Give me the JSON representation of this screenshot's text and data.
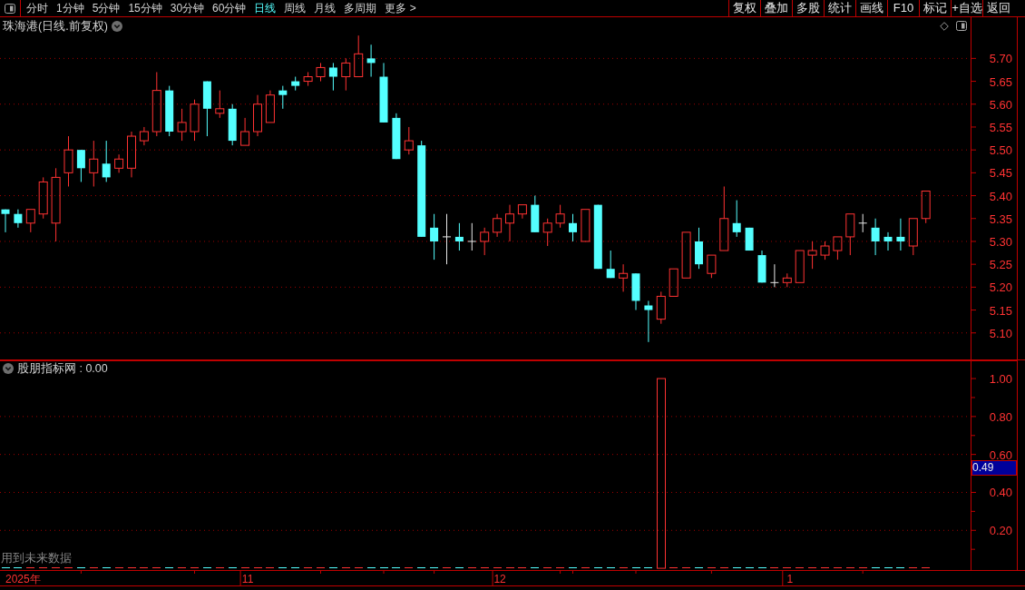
{
  "toolbar": {
    "period_tabs": [
      {
        "label": "分时",
        "selected": false
      },
      {
        "label": "1分钟",
        "selected": false
      },
      {
        "label": "5分钟",
        "selected": false
      },
      {
        "label": "15分钟",
        "selected": false
      },
      {
        "label": "30分钟",
        "selected": false
      },
      {
        "label": "60分钟",
        "selected": false
      },
      {
        "label": "日线",
        "selected": true
      },
      {
        "label": "周线",
        "selected": false
      },
      {
        "label": "月线",
        "selected": false
      },
      {
        "label": "多周期",
        "selected": false
      },
      {
        "label": "更多 >",
        "selected": false
      }
    ],
    "buttons": [
      "复权",
      "叠加",
      "多股",
      "统计",
      "画线",
      "F10",
      "标记",
      "+自选",
      "返回"
    ]
  },
  "main_chart": {
    "title": "珠海港(日线.前复权)",
    "chart_data": [
      {
        "type": "candlestick",
        "ylim": [
          5.04,
          5.79
        ],
        "yticks": [
          {
            "value": 5.1,
            "label": "5.10"
          },
          {
            "value": 5.15,
            "label": "5.15"
          },
          {
            "value": 5.2,
            "label": "5.20"
          },
          {
            "value": 5.25,
            "label": "5.25"
          },
          {
            "value": 5.3,
            "label": "5.30"
          },
          {
            "value": 5.35,
            "label": "5.35"
          },
          {
            "value": 5.4,
            "label": "5.40"
          },
          {
            "value": 5.45,
            "label": "5.45"
          },
          {
            "value": 5.5,
            "label": "5.50"
          },
          {
            "value": 5.55,
            "label": "5.55"
          },
          {
            "value": 5.6,
            "label": "5.60"
          },
          {
            "value": 5.65,
            "label": "5.65"
          },
          {
            "value": 5.7,
            "label": "5.70"
          }
        ],
        "grid": true,
        "ohlc": [
          [
            5.37,
            5.37,
            5.32,
            5.36
          ],
          [
            5.36,
            5.37,
            5.33,
            5.34
          ],
          [
            5.34,
            5.37,
            5.32,
            5.37
          ],
          [
            5.36,
            5.44,
            5.35,
            5.43
          ],
          [
            5.34,
            5.46,
            5.3,
            5.44
          ],
          [
            5.45,
            5.53,
            5.42,
            5.5
          ],
          [
            5.5,
            5.5,
            5.43,
            5.46
          ],
          [
            5.45,
            5.52,
            5.42,
            5.48
          ],
          [
            5.47,
            5.52,
            5.43,
            5.44
          ],
          [
            5.46,
            5.49,
            5.45,
            5.48
          ],
          [
            5.46,
            5.54,
            5.44,
            5.53
          ],
          [
            5.52,
            5.55,
            5.51,
            5.54
          ],
          [
            5.54,
            5.67,
            5.53,
            5.63
          ],
          [
            5.63,
            5.64,
            5.53,
            5.54
          ],
          [
            5.54,
            5.59,
            5.52,
            5.56
          ],
          [
            5.54,
            5.61,
            5.52,
            5.6
          ],
          [
            5.65,
            5.65,
            5.53,
            5.59
          ],
          [
            5.58,
            5.63,
            5.57,
            5.59
          ],
          [
            5.59,
            5.6,
            5.51,
            5.52
          ],
          [
            5.51,
            5.57,
            5.51,
            5.54
          ],
          [
            5.54,
            5.62,
            5.53,
            5.6
          ],
          [
            5.56,
            5.63,
            5.56,
            5.62
          ],
          [
            5.63,
            5.64,
            5.59,
            5.62
          ],
          [
            5.65,
            5.66,
            5.63,
            5.64
          ],
          [
            5.65,
            5.67,
            5.64,
            5.66
          ],
          [
            5.66,
            5.69,
            5.65,
            5.68
          ],
          [
            5.68,
            5.69,
            5.63,
            5.66
          ],
          [
            5.66,
            5.7,
            5.63,
            5.69
          ],
          [
            5.66,
            5.75,
            5.66,
            5.71
          ],
          [
            5.7,
            5.73,
            5.66,
            5.69
          ],
          [
            5.66,
            5.69,
            5.56,
            5.56
          ],
          [
            5.57,
            5.58,
            5.48,
            5.48
          ],
          [
            5.5,
            5.55,
            5.49,
            5.52
          ],
          [
            5.51,
            5.52,
            5.31,
            5.31
          ],
          [
            5.33,
            5.36,
            5.26,
            5.3
          ],
          [
            5.31,
            5.36,
            5.25,
            5.31
          ],
          [
            5.31,
            5.34,
            5.28,
            5.3
          ],
          [
            5.3,
            5.34,
            5.28,
            5.3
          ],
          [
            5.3,
            5.33,
            5.27,
            5.32
          ],
          [
            5.32,
            5.36,
            5.31,
            5.35
          ],
          [
            5.34,
            5.38,
            5.3,
            5.36
          ],
          [
            5.36,
            5.38,
            5.35,
            5.38
          ],
          [
            5.38,
            5.4,
            5.32,
            5.32
          ],
          [
            5.32,
            5.35,
            5.29,
            5.34
          ],
          [
            5.34,
            5.38,
            5.33,
            5.36
          ],
          [
            5.34,
            5.36,
            5.3,
            5.32
          ],
          [
            5.3,
            5.37,
            5.3,
            5.37
          ],
          [
            5.38,
            5.38,
            5.24,
            5.24
          ],
          [
            5.24,
            5.28,
            5.22,
            5.22
          ],
          [
            5.22,
            5.25,
            5.19,
            5.23
          ],
          [
            5.23,
            5.23,
            5.15,
            5.17
          ],
          [
            5.16,
            5.17,
            5.08,
            5.15
          ],
          [
            5.13,
            5.19,
            5.12,
            5.18
          ],
          [
            5.18,
            5.24,
            5.18,
            5.24
          ],
          [
            5.22,
            5.32,
            5.22,
            5.32
          ],
          [
            5.3,
            5.33,
            5.24,
            5.25
          ],
          [
            5.23,
            5.27,
            5.22,
            5.27
          ],
          [
            5.28,
            5.42,
            5.28,
            5.35
          ],
          [
            5.34,
            5.39,
            5.31,
            5.32
          ],
          [
            5.33,
            5.33,
            5.28,
            5.28
          ],
          [
            5.27,
            5.28,
            5.21,
            5.21
          ],
          [
            5.21,
            5.25,
            5.2,
            5.21
          ],
          [
            5.21,
            5.23,
            5.2,
            5.22
          ],
          [
            5.21,
            5.28,
            5.21,
            5.28
          ],
          [
            5.27,
            5.3,
            5.24,
            5.28
          ],
          [
            5.27,
            5.3,
            5.26,
            5.29
          ],
          [
            5.28,
            5.31,
            5.26,
            5.31
          ],
          [
            5.31,
            5.36,
            5.27,
            5.36
          ],
          [
            5.34,
            5.36,
            5.32,
            5.34
          ],
          [
            5.33,
            5.35,
            5.27,
            5.3
          ],
          [
            5.31,
            5.32,
            5.28,
            5.3
          ],
          [
            5.31,
            5.35,
            5.28,
            5.3
          ],
          [
            5.29,
            5.35,
            5.27,
            5.35
          ],
          [
            5.35,
            5.41,
            5.34,
            5.41
          ]
        ]
      }
    ]
  },
  "indicator": {
    "header": "股朋指标网 : 0.00",
    "value_marker": "0.49",
    "note": "用到未来数据",
    "time_axis_year": "2025年",
    "chart_data": [
      {
        "type": "bar",
        "ylim": [
          -0.014,
          1.096
        ],
        "yticks": [
          {
            "value": 0.2,
            "label": "0.20"
          },
          {
            "value": 0.4,
            "label": "0.40"
          },
          {
            "value": 0.6,
            "label": "0.60"
          },
          {
            "value": 0.8,
            "label": "0.80"
          },
          {
            "value": 1.0,
            "label": "1.00"
          }
        ],
        "grid": true,
        "categories": [
          null,
          null,
          null,
          null,
          null,
          null,
          null,
          null,
          null,
          null,
          null,
          null,
          null,
          null,
          null,
          null,
          null,
          null,
          null,
          "11",
          null,
          null,
          null,
          null,
          null,
          null,
          null,
          null,
          null,
          null,
          null,
          null,
          null,
          null,
          null,
          null,
          null,
          null,
          null,
          "12",
          null,
          null,
          null,
          null,
          null,
          null,
          null,
          null,
          null,
          null,
          null,
          null,
          null,
          null,
          null,
          null,
          null,
          null,
          null,
          null,
          null,
          null,
          "1",
          null,
          null,
          null,
          null,
          null,
          null,
          null,
          null,
          null,
          null,
          null
        ],
        "values": [
          0,
          0,
          0,
          0,
          0,
          0,
          0,
          0,
          0,
          0,
          0,
          0,
          0,
          0,
          0,
          0,
          0,
          0,
          0,
          0,
          0,
          0,
          0,
          0,
          0,
          0,
          0,
          0,
          0,
          0,
          0,
          0,
          0,
          0,
          0,
          0,
          0,
          0,
          0,
          0,
          0,
          0,
          0,
          0,
          0,
          0,
          0,
          0,
          0,
          0,
          0,
          0,
          1,
          0,
          0,
          0,
          0,
          0,
          0,
          0,
          0,
          0,
          0,
          0,
          0,
          0,
          0,
          0,
          0,
          0,
          0,
          0,
          0,
          0
        ],
        "colors": [
          "#54ffff",
          "#54ffff",
          "#ff3232",
          "#ff3232",
          "#ff3232",
          "#ff3232",
          "#54ffff",
          "#ff3232",
          "#54ffff",
          "#ff3232",
          "#ff3232",
          "#ff3232",
          "#ff3232",
          "#54ffff",
          "#ff3232",
          "#ff3232",
          "#54ffff",
          "#ff3232",
          "#54ffff",
          "#ff3232",
          "#ff3232",
          "#ff3232",
          "#54ffff",
          "#54ffff",
          "#ff3232",
          "#ff3232",
          "#54ffff",
          "#ff3232",
          "#ff3232",
          "#54ffff",
          "#54ffff",
          "#54ffff",
          "#ff3232",
          "#54ffff",
          "#54ffff",
          "#ff3232",
          "#54ffff",
          "#ff3232",
          "#ff3232",
          "#ff3232",
          "#ff3232",
          "#ff3232",
          "#54ffff",
          "#ff3232",
          "#ff3232",
          "#54ffff",
          "#ff3232",
          "#54ffff",
          "#54ffff",
          "#ff3232",
          "#54ffff",
          "#54ffff",
          "#ff3232",
          "#ff3232",
          "#ff3232",
          "#54ffff",
          "#ff3232",
          "#ff3232",
          "#54ffff",
          "#54ffff",
          "#54ffff",
          "#ff3232",
          "#ff3232",
          "#ff3232",
          "#ff3232",
          "#ff3232",
          "#ff3232",
          "#ff3232",
          "#ff3232",
          "#54ffff",
          "#54ffff",
          "#54ffff",
          "#ff3232",
          "#ff3232"
        ]
      }
    ]
  }
}
